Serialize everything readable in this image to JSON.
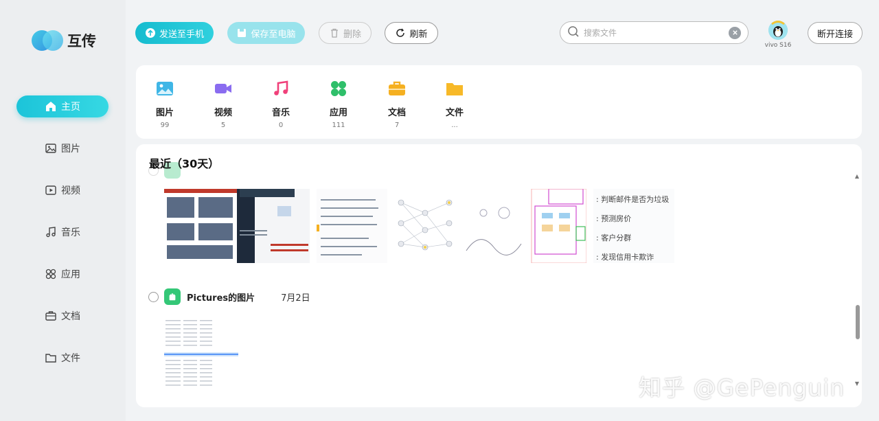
{
  "app": {
    "name": "互传"
  },
  "sidebar": {
    "items": [
      {
        "label": "主页",
        "icon": "home-icon",
        "active": true
      },
      {
        "label": "图片",
        "icon": "image-icon"
      },
      {
        "label": "视频",
        "icon": "video-icon"
      },
      {
        "label": "音乐",
        "icon": "music-icon"
      },
      {
        "label": "应用",
        "icon": "apps-icon"
      },
      {
        "label": "文档",
        "icon": "briefcase-icon"
      },
      {
        "label": "文件",
        "icon": "folder-icon"
      }
    ]
  },
  "toolbar": {
    "send_label": "发送至手机",
    "save_label": "保存至电脑",
    "delete_label": "删除",
    "refresh_label": "刷新",
    "search_placeholder": "搜索文件",
    "device_name": "vivo S16",
    "disconnect_label": "断开连接"
  },
  "categories": [
    {
      "label": "图片",
      "count": "99",
      "icon": "image-icon",
      "color": "#3fb6e6"
    },
    {
      "label": "视频",
      "count": "5",
      "icon": "video-icon",
      "color": "#8a6cf0"
    },
    {
      "label": "音乐",
      "count": "0",
      "icon": "music-icon",
      "color": "#f0407a"
    },
    {
      "label": "应用",
      "count": "111",
      "icon": "apps-icon",
      "color": "#2fbf6a"
    },
    {
      "label": "文档",
      "count": "7",
      "icon": "briefcase-icon",
      "color": "#f5b021"
    },
    {
      "label": "文件",
      "count": "...",
      "icon": "folder-icon",
      "color": "#f7b928"
    }
  ],
  "recent": {
    "title": "最近（30天）",
    "groups": [
      {
        "name": "Pictures的图片",
        "date": "7月2日"
      }
    ]
  },
  "thumb_text": {
    "t4_lines": [
      ": 判断邮件是否为垃圾",
      ": 预测房价",
      ": 客户分群",
      ": 发现信用卡欺诈"
    ]
  },
  "watermark": "知乎 @GePenguin",
  "colors": {
    "accent": "#1cc4d9",
    "accent_light": "#98e3ec",
    "group_icon": "#34c777"
  }
}
